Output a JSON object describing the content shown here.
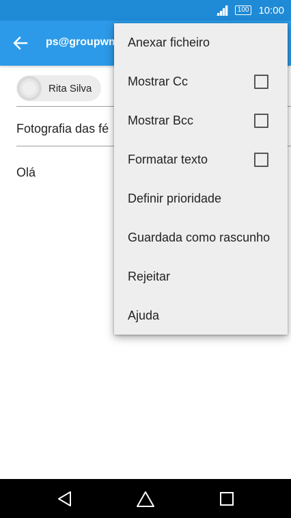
{
  "status_bar": {
    "battery_level": "100",
    "time": "10:00",
    "icons": [
      "signal-icon",
      "battery-icon"
    ],
    "color": "#1f8ad6"
  },
  "app_bar": {
    "back_icon": "arrow-left-icon",
    "from_address": "ps@groupwm",
    "color": "#2c9ae8"
  },
  "compose": {
    "recipients": [
      {
        "name": "Rita Silva",
        "avatar_icon": "person-avatar-icon"
      }
    ],
    "subject": "Fotografia das fé",
    "body": "Olá"
  },
  "overflow_menu": {
    "items": [
      {
        "label": "Anexar ficheiro",
        "has_checkbox": false
      },
      {
        "label": "Mostrar Cc",
        "has_checkbox": true,
        "checked": false
      },
      {
        "label": "Mostrar Bcc",
        "has_checkbox": true,
        "checked": false
      },
      {
        "label": "Formatar texto",
        "has_checkbox": true,
        "checked": false
      },
      {
        "label": "Definir prioridade",
        "has_checkbox": false
      },
      {
        "label": "Guardada como rascunho",
        "has_checkbox": false
      },
      {
        "label": "Rejeitar",
        "has_checkbox": false
      },
      {
        "label": "Ajuda",
        "has_checkbox": false
      }
    ]
  },
  "nav_bar": {
    "back_icon": "triangle-back-icon",
    "home_icon": "home-icon",
    "recents_icon": "square-recents-icon"
  }
}
